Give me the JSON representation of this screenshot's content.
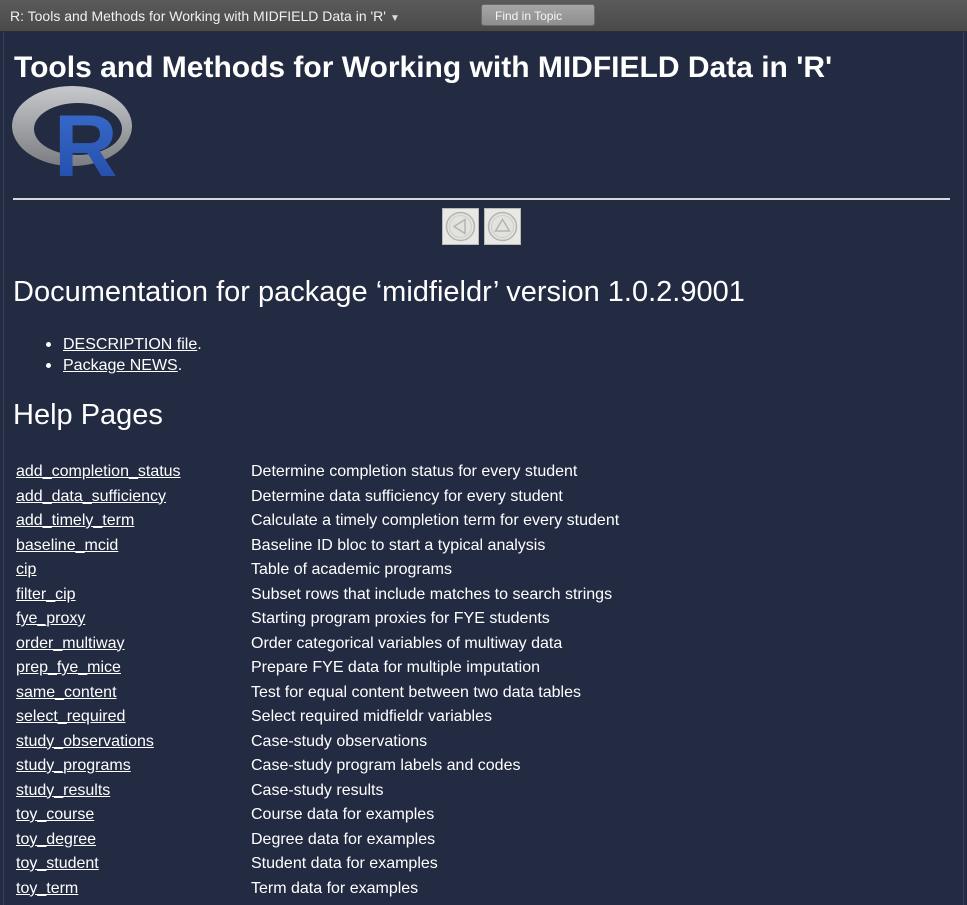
{
  "toolbar": {
    "topic_title": "R: Tools and Methods for Working with MIDFIELD Data in 'R'",
    "find_button": "Find in Topic"
  },
  "page": {
    "title": "Tools and Methods for Working with MIDFIELD Data in 'R'",
    "logo_letter": "R",
    "nav": {
      "back_icon": "left-arrow-icon",
      "up_icon": "up-arrow-icon"
    },
    "doc_heading": "Documentation for package ‘midfieldr’ version 1.0.2.9001",
    "links": [
      {
        "text": "DESCRIPTION file",
        "suffix": "."
      },
      {
        "text": "Package NEWS",
        "suffix": "."
      }
    ],
    "help_heading": "Help Pages",
    "help_pages": [
      {
        "name": "add_completion_status",
        "desc": "Determine completion status for every student"
      },
      {
        "name": "add_data_sufficiency",
        "desc": "Determine data sufficiency for every student"
      },
      {
        "name": "add_timely_term",
        "desc": "Calculate a timely completion term for every student"
      },
      {
        "name": "baseline_mcid",
        "desc": "Baseline ID bloc to start a typical analysis"
      },
      {
        "name": "cip",
        "desc": "Table of academic programs"
      },
      {
        "name": "filter_cip",
        "desc": "Subset rows that include matches to search strings"
      },
      {
        "name": "fye_proxy",
        "desc": "Starting program proxies for FYE students"
      },
      {
        "name": "order_multiway",
        "desc": "Order categorical variables of multiway data"
      },
      {
        "name": "prep_fye_mice",
        "desc": "Prepare FYE data for multiple imputation"
      },
      {
        "name": "same_content",
        "desc": "Test for equal content between two data tables"
      },
      {
        "name": "select_required",
        "desc": "Select required midfieldr variables"
      },
      {
        "name": "study_observations",
        "desc": "Case-study observations"
      },
      {
        "name": "study_programs",
        "desc": "Case-study program labels and codes"
      },
      {
        "name": "study_results",
        "desc": "Case-study results"
      },
      {
        "name": "toy_course",
        "desc": "Course data for examples"
      },
      {
        "name": "toy_degree",
        "desc": "Degree data for examples"
      },
      {
        "name": "toy_student",
        "desc": "Student data for examples"
      },
      {
        "name": "toy_term",
        "desc": "Term data for examples"
      }
    ]
  },
  "colors": {
    "background": "#232b42",
    "text": "#ffffff",
    "toolbar": "#505050",
    "logo_ring": "#9a9ba0",
    "logo_letter": "#2a58b8"
  }
}
